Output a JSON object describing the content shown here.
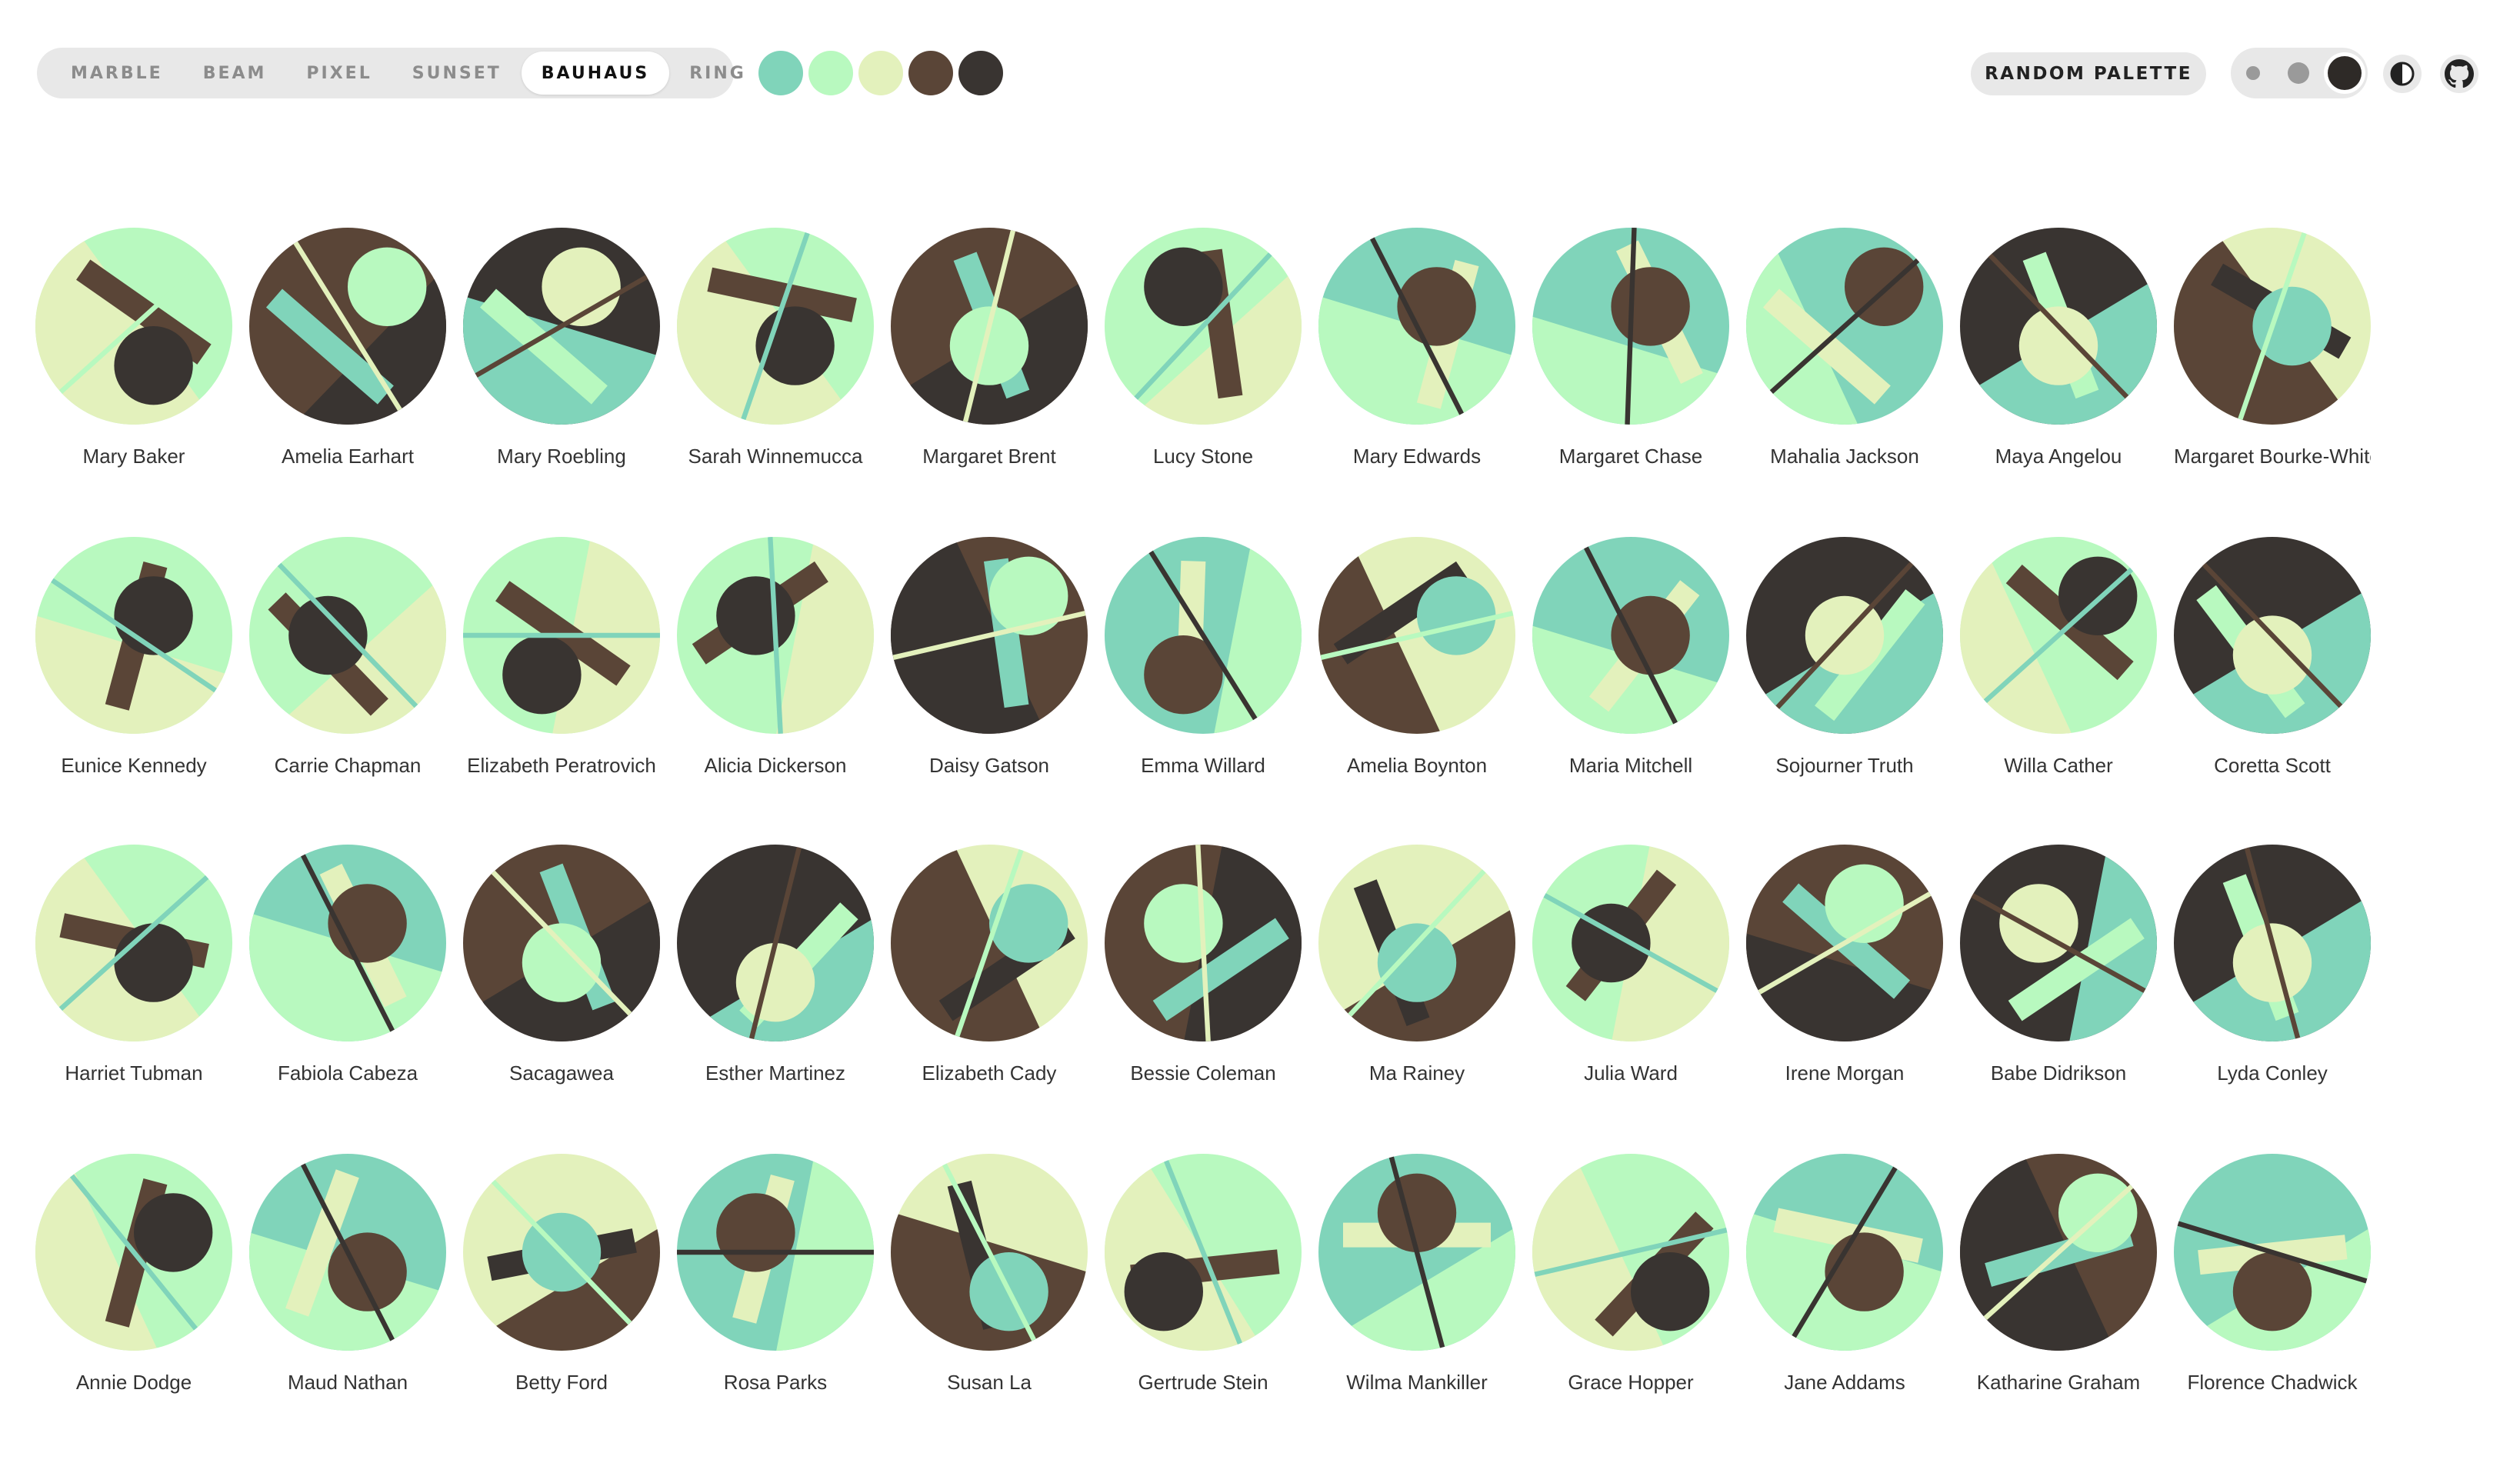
{
  "variants": [
    "Marble",
    "Beam",
    "Pixel",
    "Sunset",
    "Bauhaus",
    "Ring"
  ],
  "active_variant": "Bauhaus",
  "palette": [
    "#80d4ba",
    "#b8f9bf",
    "#e3f1bc",
    "#5a4537",
    "#393431"
  ],
  "random_palette_label": "RANDOM PALETTE",
  "sizes": [
    "small",
    "medium",
    "large"
  ],
  "active_size": "large",
  "icons": {
    "theme": "contrast-icon",
    "github": "github-icon"
  },
  "avatars": [
    {
      "name": "Mary Baker",
      "shapes": [
        1,
        2,
        3,
        4,
        1,
        3,
        3,
        0,
        3,
        4,
        1,
        3
      ]
    },
    {
      "name": "Amelia Earhart",
      "shapes": [
        3,
        4,
        0,
        1,
        2,
        0,
        4,
        4,
        1,
        0,
        4,
        2
      ]
    },
    {
      "name": "Mary Roebling",
      "shapes": [
        4,
        0,
        1,
        2,
        3,
        2,
        3,
        1,
        1,
        0,
        4,
        4
      ]
    },
    {
      "name": "Sarah Winnemucca",
      "shapes": [
        1,
        2,
        3,
        4,
        0,
        3,
        3,
        0,
        3,
        3,
        0,
        2
      ]
    },
    {
      "name": "Margaret Brent",
      "shapes": [
        3,
        4,
        0,
        1,
        2,
        1,
        2,
        2,
        0,
        3,
        2,
        3
      ]
    },
    {
      "name": "Lucy Stone",
      "shapes": [
        1,
        2,
        3,
        4,
        0,
        1,
        1,
        3,
        2,
        0,
        1,
        4
      ]
    },
    {
      "name": "Mary Edwards",
      "shapes": [
        0,
        1,
        2,
        3,
        4,
        2,
        3,
        1,
        2,
        1,
        0,
        1
      ]
    },
    {
      "name": "Margaret Chase",
      "shapes": [
        0,
        1,
        2,
        3,
        4,
        2,
        3,
        3,
        1,
        1,
        0,
        2
      ]
    },
    {
      "name": "Mahalia Jackson",
      "shapes": [
        0,
        1,
        2,
        3,
        4,
        3,
        4,
        4,
        1,
        0,
        4,
        3
      ]
    },
    {
      "name": "Maya Angelou",
      "shapes": [
        4,
        0,
        1,
        2,
        3,
        1,
        2,
        2,
        0,
        3,
        2,
        1
      ]
    },
    {
      "name": "Margaret Bourke-White",
      "shapes": [
        2,
        3,
        4,
        0,
        1,
        3,
        3,
        0,
        4,
        2,
        1,
        2
      ]
    },
    {
      "name": "Eunice Kennedy",
      "shapes": [
        1,
        2,
        3,
        4,
        0,
        2,
        3,
        2,
        2,
        1,
        2,
        0
      ]
    },
    {
      "name": "Carrie Chapman",
      "shapes": [
        1,
        2,
        3,
        4,
        0,
        1,
        1,
        3,
        0,
        2,
        4,
        1
      ]
    },
    {
      "name": "Elizabeth Peratrovich",
      "shapes": [
        1,
        2,
        3,
        4,
        0,
        0,
        1,
        2,
        3,
        4,
        2,
        0
      ]
    },
    {
      "name": "Alicia Dickerson",
      "shapes": [
        1,
        2,
        3,
        4,
        0,
        0,
        1,
        3,
        3,
        1,
        4,
        3
      ]
    },
    {
      "name": "Daisy Gatson",
      "shapes": [
        3,
        4,
        0,
        1,
        2,
        3,
        4,
        0,
        2,
        0,
        1,
        4
      ]
    },
    {
      "name": "Emma Willard",
      "shapes": [
        0,
        1,
        2,
        3,
        4,
        0,
        1,
        4,
        0,
        4,
        3,
        2
      ]
    },
    {
      "name": "Amelia Boynton",
      "shapes": [
        2,
        3,
        4,
        0,
        1,
        3,
        4,
        3,
        3,
        1,
        4,
        4
      ]
    },
    {
      "name": "Maria Mitchell",
      "shapes": [
        0,
        1,
        2,
        3,
        4,
        2,
        3,
        3,
        2,
        2,
        1,
        1
      ]
    },
    {
      "name": "Sojourner Truth",
      "shapes": [
        4,
        0,
        1,
        2,
        3,
        1,
        2,
        2,
        2,
        2,
        0,
        4
      ]
    },
    {
      "name": "Willa Cather",
      "shapes": [
        1,
        2,
        3,
        4,
        0,
        3,
        4,
        4,
        1,
        0,
        1,
        3
      ]
    },
    {
      "name": "Coretta Scott",
      "shapes": [
        4,
        0,
        1,
        2,
        3,
        1,
        2,
        2,
        4,
        3,
        4,
        1
      ]
    },
    {
      "name": "Harriet Tubman",
      "shapes": [
        1,
        2,
        3,
        4,
        0,
        3,
        3,
        0,
        3,
        3,
        2,
        3
      ]
    },
    {
      "name": "Fabiola Cabeza",
      "shapes": [
        0,
        1,
        2,
        3,
        4,
        2,
        3,
        1,
        1,
        1,
        1,
        1
      ]
    },
    {
      "name": "Sacagawea",
      "shapes": [
        3,
        4,
        0,
        1,
        2,
        1,
        2,
        2,
        0,
        3,
        1,
        1
      ]
    },
    {
      "name": "Esther Martinez",
      "shapes": [
        4,
        0,
        1,
        2,
        3,
        1,
        2,
        4,
        1,
        4,
        0,
        3
      ]
    },
    {
      "name": "Elizabeth Cady",
      "shapes": [
        2,
        3,
        4,
        0,
        1,
        3,
        4,
        0,
        3,
        1,
        0,
        2
      ]
    },
    {
      "name": "Bessie Coleman",
      "shapes": [
        3,
        4,
        0,
        1,
        2,
        0,
        1,
        1,
        3,
        1,
        0,
        3
      ]
    },
    {
      "name": "Ma Rainey",
      "shapes": [
        2,
        3,
        4,
        0,
        1,
        1,
        2,
        3,
        0,
        3,
        4,
        4
      ]
    },
    {
      "name": "Julia Ward",
      "shapes": [
        1,
        2,
        3,
        4,
        0,
        0,
        1,
        1,
        2,
        2,
        3,
        1
      ]
    },
    {
      "name": "Irene Morgan",
      "shapes": [
        3,
        4,
        0,
        1,
        2,
        2,
        3,
        3,
        1,
        0,
        2,
        4
      ]
    },
    {
      "name": "Babe Didrikson",
      "shapes": [
        4,
        0,
        1,
        2,
        3,
        0,
        1,
        4,
        3,
        1,
        0,
        1
      ]
    },
    {
      "name": "Lyda Conley",
      "shapes": [
        4,
        0,
        1,
        2,
        3,
        1,
        2,
        2,
        0,
        3,
        3,
        2
      ]
    },
    {
      "name": "Annie Dodge",
      "shapes": [
        1,
        2,
        3,
        4,
        0,
        3,
        4,
        3,
        2,
        1,
        2,
        0
      ]
    },
    {
      "name": "Maud Nathan",
      "shapes": [
        0,
        1,
        2,
        3,
        4,
        2,
        3,
        2,
        1,
        3,
        4,
        1
      ]
    },
    {
      "name": "Betty Ford",
      "shapes": [
        2,
        3,
        4,
        0,
        1,
        1,
        2,
        4,
        3,
        2,
        2,
        1
      ]
    },
    {
      "name": "Rosa Parks",
      "shapes": [
        0,
        1,
        2,
        3,
        4,
        0,
        1,
        3,
        2,
        1,
        3,
        0
      ]
    },
    {
      "name": "Susan La",
      "shapes": [
        2,
        3,
        4,
        0,
        1,
        2,
        3,
        0,
        4,
        4,
        3,
        1
      ]
    },
    {
      "name": "Gertrude Stein",
      "shapes": [
        1,
        2,
        3,
        4,
        0,
        4,
        0,
        1,
        2,
        4,
        1,
        0
      ]
    },
    {
      "name": "Wilma Mankiller",
      "shapes": [
        0,
        1,
        2,
        3,
        4,
        1,
        2,
        4,
        0,
        0,
        1,
        2
      ]
    },
    {
      "name": "Grace Hopper",
      "shapes": [
        1,
        2,
        3,
        4,
        0,
        3,
        4,
        2,
        1,
        4,
        0,
        4
      ]
    },
    {
      "name": "Jane Addams",
      "shapes": [
        0,
        1,
        2,
        3,
        4,
        2,
        3,
        0,
        3,
        3,
        1,
        3
      ]
    },
    {
      "name": "Katharine Graham",
      "shapes": [
        3,
        4,
        0,
        1,
        2,
        3,
        4,
        0,
        4,
        0,
        2,
        3
      ]
    },
    {
      "name": "Florence Chadwick",
      "shapes": [
        0,
        1,
        2,
        3,
        4,
        1,
        2,
        4,
        2,
        4,
        2,
        0
      ]
    }
  ]
}
